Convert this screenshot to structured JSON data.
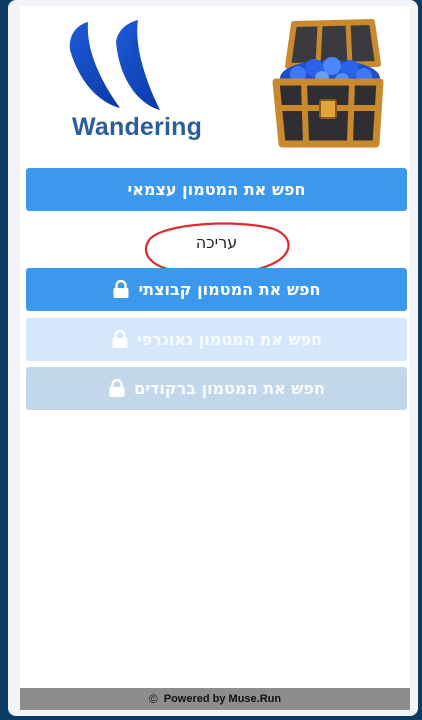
{
  "colors": {
    "primary_button": "#3c98ec",
    "disabled_button_light": "#d5e7fb",
    "disabled_button_grey": "#c3d7ea",
    "annotation_circle": "#e0282f",
    "brand_text": "#2a5e9b",
    "footer_bg": "#8d8d8d"
  },
  "header": {
    "logo_text": "Wandering",
    "logo_icon": "blue-feathers-logo",
    "illustration": "treasure-chest-with-blue-gems"
  },
  "menu": {
    "self_hunt_label": "חפש את המטמון עצמאי",
    "edit_label": "עריכה",
    "group_hunt_label": "חפש את המטמון קבוצתי",
    "geo_hunt_label": "חפש את המטמון גאוגרפי",
    "barcode_hunt_label": "חפש את המטמון ברקודים",
    "lock_icon": "lock-icon"
  },
  "footer": {
    "copyright_symbol": "©",
    "text": "Powered by Muse.Run"
  }
}
